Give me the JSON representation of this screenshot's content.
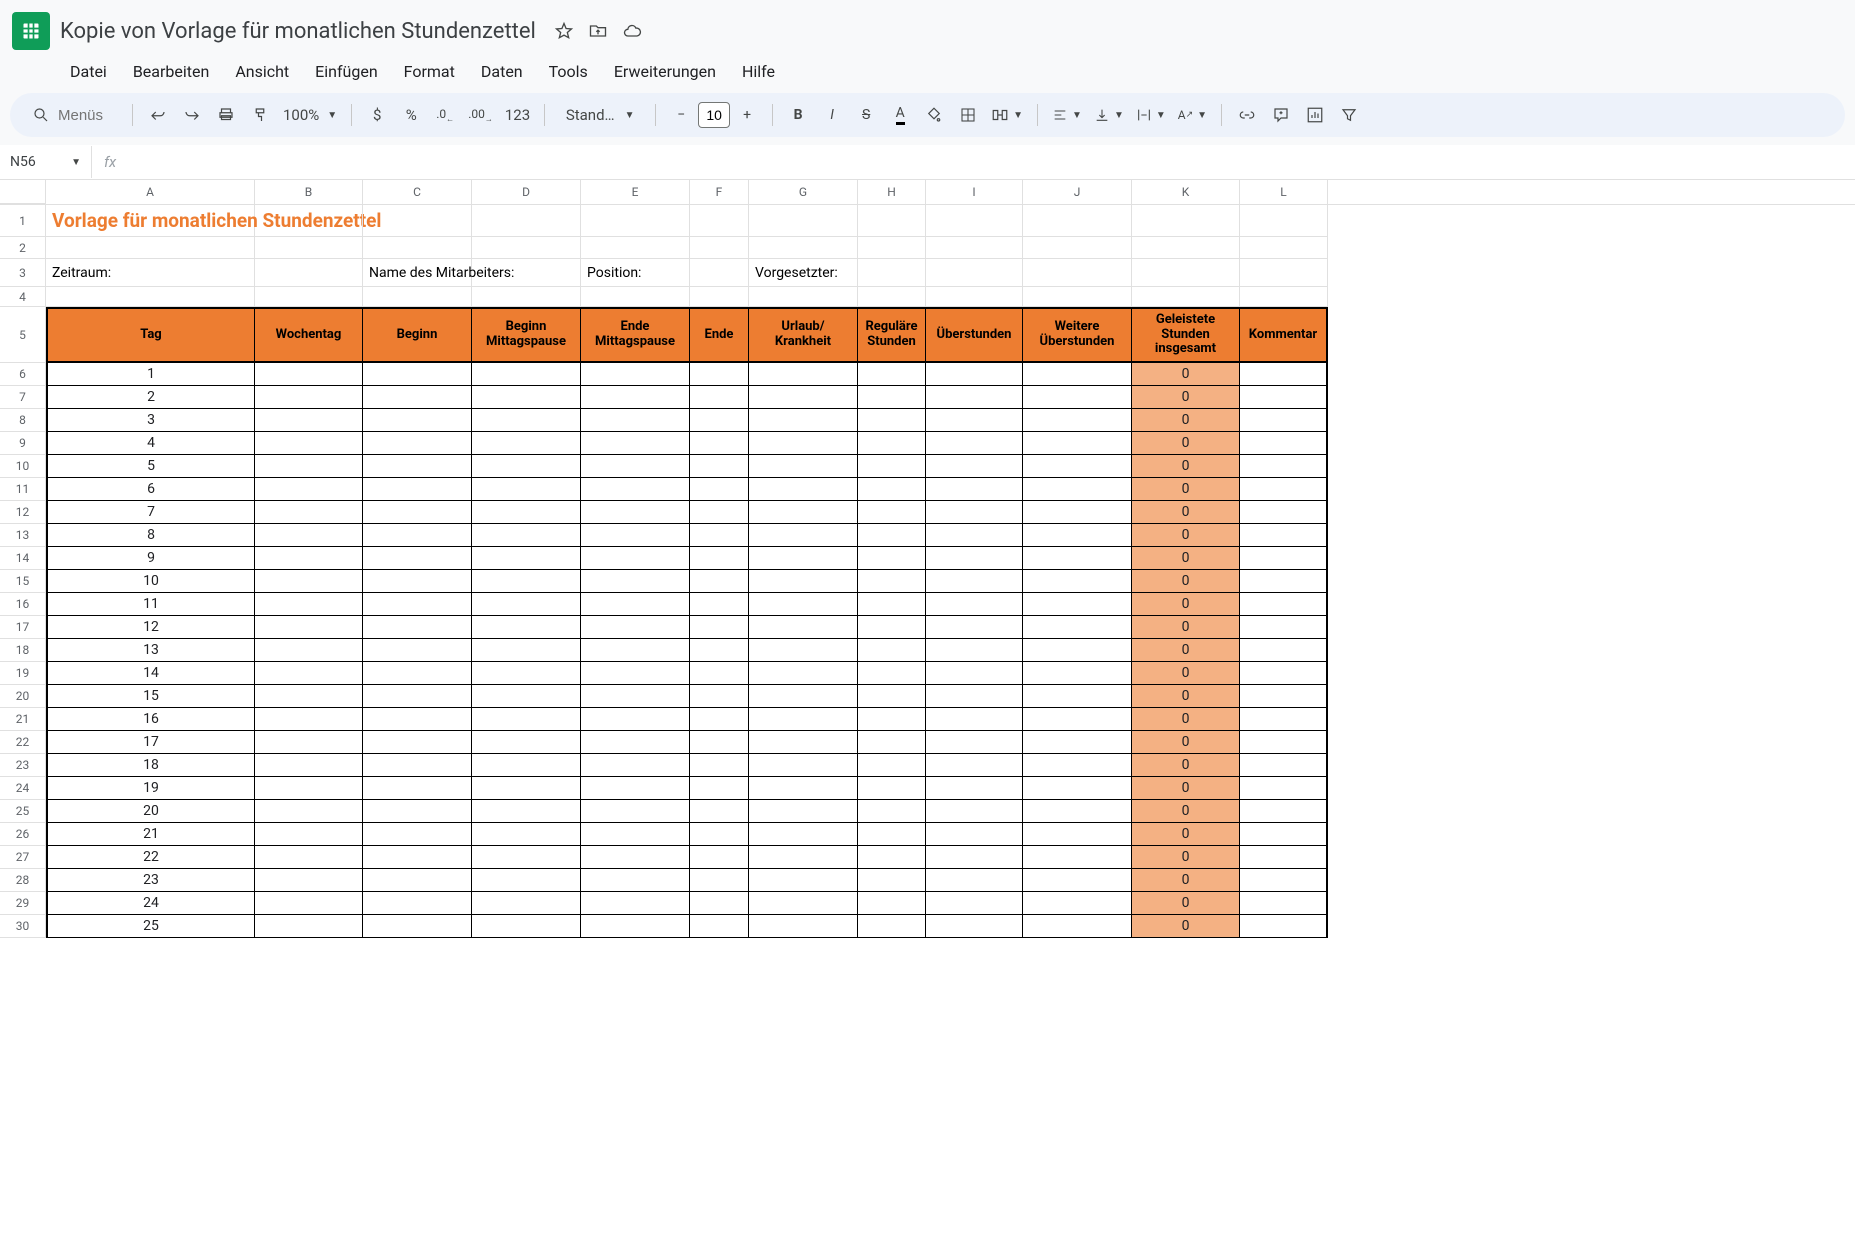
{
  "doc_title": "Kopie von Vorlage für monatlichen Stundenzettel",
  "menubar": [
    "Datei",
    "Bearbeiten",
    "Ansicht",
    "Einfügen",
    "Format",
    "Daten",
    "Tools",
    "Erweiterungen",
    "Hilfe"
  ],
  "toolbar": {
    "search_placeholder": "Menüs",
    "zoom": "100%",
    "currency": "$",
    "percent": "%",
    "dec_dec": ".0",
    "inc_dec": ".00",
    "num_fmt": "123",
    "font_name": "Stand…",
    "font_size": "10"
  },
  "name_box": "N56",
  "columns": [
    "A",
    "B",
    "C",
    "D",
    "E",
    "F",
    "G",
    "H",
    "I",
    "J",
    "K",
    "L"
  ],
  "col_classes": [
    "cA",
    "cB",
    "cC",
    "cD",
    "cE",
    "cF",
    "cG",
    "cH",
    "cI",
    "cJ",
    "cK",
    "cL"
  ],
  "sheet": {
    "title": "Vorlage für monatlichen Stundenzettel",
    "labels": {
      "zeitraum": "Zeitraum:",
      "name": "Name des Mitarbeiters:",
      "position": "Position:",
      "vorgesetzter": "Vorgesetzter:"
    },
    "headers": [
      "Tag",
      "Wochentag",
      "Beginn",
      "Beginn Mittagspause",
      "Ende Mittagspause",
      "Ende",
      "Urlaub/ Krankheit",
      "Reguläre Stunden",
      "Überstunden",
      "Weitere Überstunden",
      "Geleistete Stunden insgesamt",
      "Kommentar"
    ],
    "data_rows": [
      {
        "n": 6,
        "tag": "1",
        "k": "0"
      },
      {
        "n": 7,
        "tag": "2",
        "k": "0"
      },
      {
        "n": 8,
        "tag": "3",
        "k": "0"
      },
      {
        "n": 9,
        "tag": "4",
        "k": "0"
      },
      {
        "n": 10,
        "tag": "5",
        "k": "0"
      },
      {
        "n": 11,
        "tag": "6",
        "k": "0"
      },
      {
        "n": 12,
        "tag": "7",
        "k": "0"
      },
      {
        "n": 13,
        "tag": "8",
        "k": "0"
      },
      {
        "n": 14,
        "tag": "9",
        "k": "0"
      },
      {
        "n": 15,
        "tag": "10",
        "k": "0"
      },
      {
        "n": 16,
        "tag": "11",
        "k": "0"
      },
      {
        "n": 17,
        "tag": "12",
        "k": "0"
      },
      {
        "n": 18,
        "tag": "13",
        "k": "0"
      },
      {
        "n": 19,
        "tag": "14",
        "k": "0"
      },
      {
        "n": 20,
        "tag": "15",
        "k": "0"
      },
      {
        "n": 21,
        "tag": "16",
        "k": "0"
      },
      {
        "n": 22,
        "tag": "17",
        "k": "0"
      },
      {
        "n": 23,
        "tag": "18",
        "k": "0"
      },
      {
        "n": 24,
        "tag": "19",
        "k": "0"
      },
      {
        "n": 25,
        "tag": "20",
        "k": "0"
      },
      {
        "n": 26,
        "tag": "21",
        "k": "0"
      },
      {
        "n": 27,
        "tag": "22",
        "k": "0"
      },
      {
        "n": 28,
        "tag": "23",
        "k": "0"
      },
      {
        "n": 29,
        "tag": "24",
        "k": "0"
      },
      {
        "n": 30,
        "tag": "25",
        "k": "0"
      }
    ]
  }
}
